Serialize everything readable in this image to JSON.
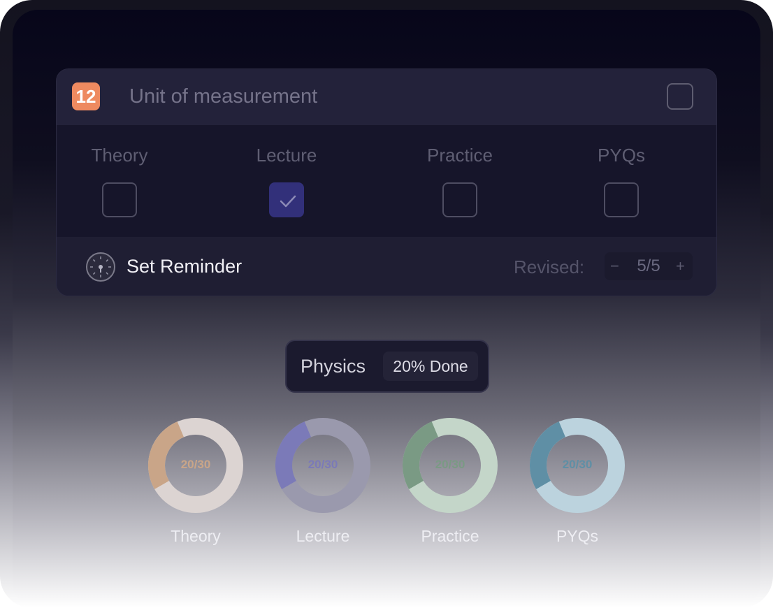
{
  "unit": {
    "number": "12",
    "title": "Unit of measurement"
  },
  "categories": [
    {
      "label": "Theory",
      "checked": false
    },
    {
      "label": "Lecture",
      "checked": true
    },
    {
      "label": "Practice",
      "checked": false
    },
    {
      "label": "PYQs",
      "checked": false
    }
  ],
  "reminder": {
    "label": "Set Reminder",
    "icon": "clock-icon"
  },
  "revised": {
    "label": "Revised:",
    "decrement": "−",
    "value": "5/5",
    "increment": "+"
  },
  "subject": {
    "name": "Physics",
    "progress_text": "20% Done"
  },
  "progress_rings": [
    {
      "label": "Theory",
      "done": "20",
      "total": "30",
      "fraction": 0.27,
      "color": "#c9a588",
      "track": "#dcd4d2"
    },
    {
      "label": "Lecture",
      "done": "20",
      "total": "30",
      "fraction": 0.27,
      "color": "#7b7ab8",
      "track": "#9a99ad"
    },
    {
      "label": "Practice",
      "done": "20",
      "total": "30",
      "fraction": 0.27,
      "color": "#7a9a84",
      "track": "#c4d6c9"
    },
    {
      "label": "PYQs",
      "done": "20",
      "total": "30",
      "fraction": 0.27,
      "color": "#5f8fa5",
      "track": "#bcd3de"
    }
  ],
  "colors": {
    "accent_orange": "#ee8a60",
    "checked_purple": "#32307a",
    "card_bg": "#1e1d33"
  }
}
